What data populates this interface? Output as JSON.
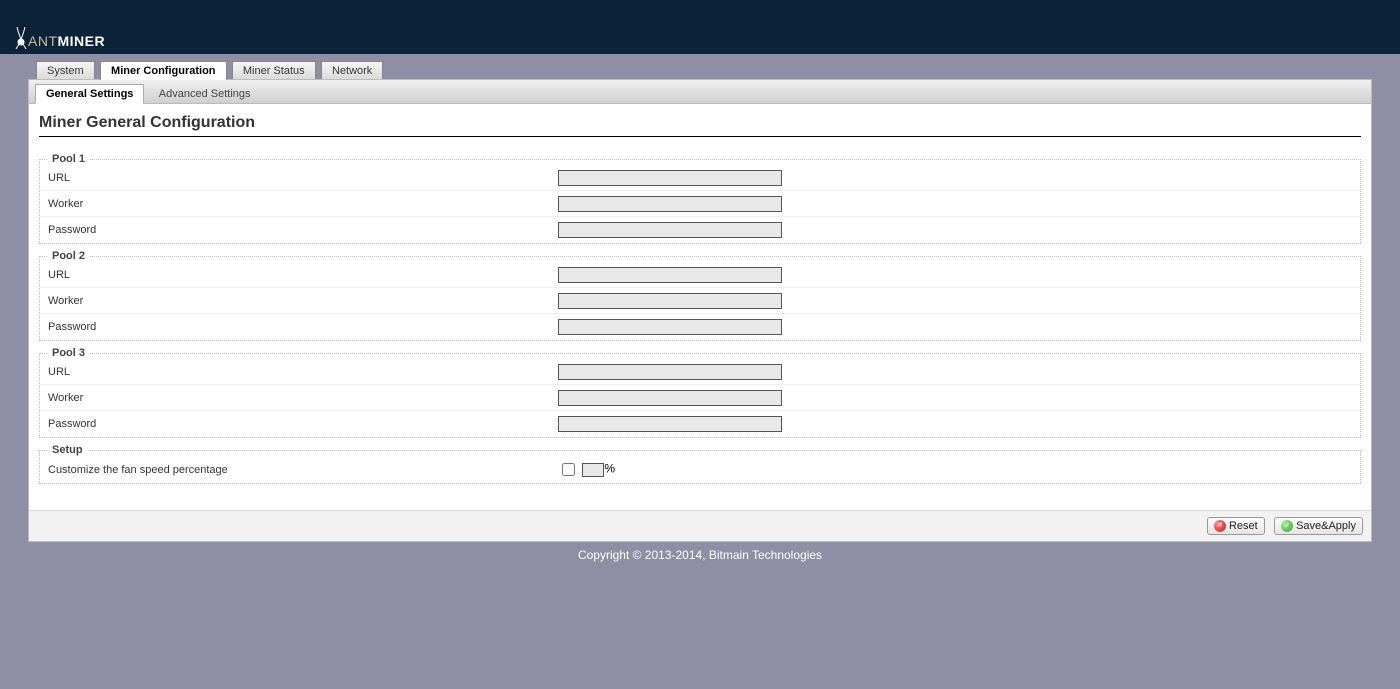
{
  "brand": {
    "ant": "ANT",
    "miner": "MINER"
  },
  "tabs": {
    "system": "System",
    "miner_config": "Miner Configuration",
    "miner_status": "Miner Status",
    "network": "Network"
  },
  "subtabs": {
    "general": "General Settings",
    "advanced": "Advanced Settings"
  },
  "page_title": "Miner General Configuration",
  "pools": [
    {
      "legend": "Pool 1",
      "url_label": "URL",
      "url_value": "",
      "worker_label": "Worker",
      "worker_value": "",
      "password_label": "Password",
      "password_value": ""
    },
    {
      "legend": "Pool 2",
      "url_label": "URL",
      "url_value": "",
      "worker_label": "Worker",
      "worker_value": "",
      "password_label": "Password",
      "password_value": ""
    },
    {
      "legend": "Pool 3",
      "url_label": "URL",
      "url_value": "",
      "worker_label": "Worker",
      "worker_value": "",
      "password_label": "Password",
      "password_value": ""
    }
  ],
  "setup": {
    "legend": "Setup",
    "fan_label": "Customize the fan speed percentage",
    "fan_checked": false,
    "fan_value": "",
    "percent_sign": "%"
  },
  "buttons": {
    "reset": "Reset",
    "save_apply": "Save&Apply"
  },
  "copyright": "Copyright © 2013-2014, Bitmain Technologies"
}
